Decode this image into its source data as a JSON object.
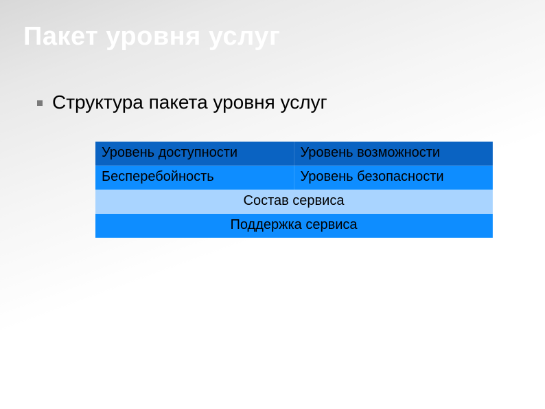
{
  "title": "Пакет уровня услуг",
  "bullet": "Структура пакета уровня услуг",
  "table": {
    "r1c1": "Уровень доступности",
    "r1c2": "Уровень возможности",
    "r2c1": "Бесперебойность",
    "r2c2": "Уровень безопасности",
    "r3": "Состав сервиса",
    "r4": "Поддержка сервиса"
  },
  "colors": {
    "row_dark": "#0a63c2",
    "row_blue": "#0e8dff",
    "row_light": "#a9d4ff"
  },
  "chart_data": {
    "type": "table",
    "rows": [
      [
        "Уровень доступности",
        "Уровень возможности"
      ],
      [
        "Бесперебойность",
        "Уровень безопасности"
      ],
      [
        "Состав сервиса"
      ],
      [
        "Поддержка сервиса"
      ]
    ]
  }
}
